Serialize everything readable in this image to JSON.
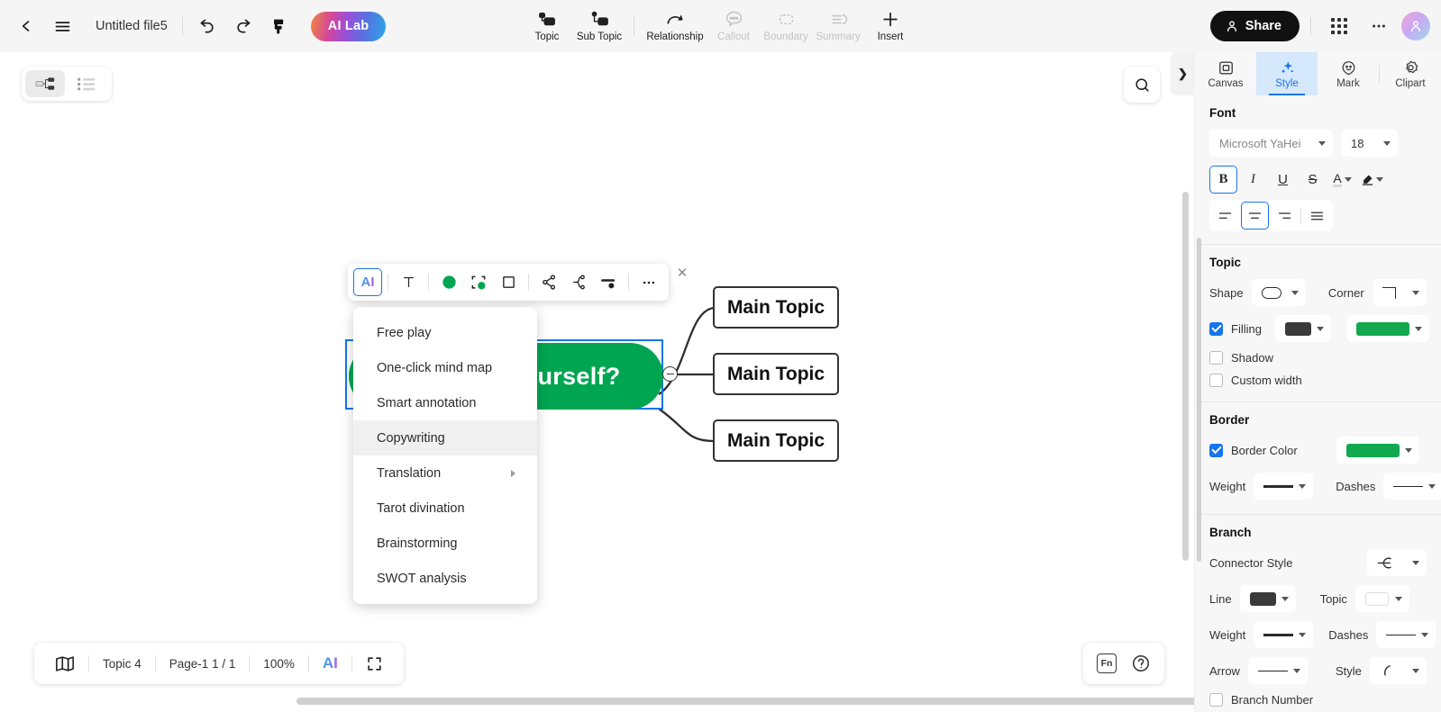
{
  "topbar": {
    "back_icon": "chevron-left-icon",
    "menu_icon": "hamburger-menu-icon",
    "file_title": "Untitled file5",
    "undo_icon": "undo-icon",
    "redo_icon": "redo-icon",
    "format_painter_icon": "format-painter-icon",
    "ai_lab_label": "AI Lab",
    "tools": [
      {
        "label": "Topic",
        "icon": "topic-icon",
        "disabled": false
      },
      {
        "label": "Sub Topic",
        "icon": "sub-topic-icon",
        "disabled": false
      },
      {
        "label": "Relationship",
        "icon": "relationship-icon",
        "disabled": false
      },
      {
        "label": "Callout",
        "icon": "callout-icon",
        "disabled": true
      },
      {
        "label": "Boundary",
        "icon": "boundary-icon",
        "disabled": true
      },
      {
        "label": "Summary",
        "icon": "summary-icon",
        "disabled": true
      },
      {
        "label": "Insert",
        "icon": "plus-icon",
        "disabled": false
      }
    ],
    "share_label": "Share",
    "apps_icon": "apps-grid-icon",
    "more_icon": "more-horizontal-icon",
    "avatar_icon": "user-avatar"
  },
  "canvas": {
    "view_toggle": {
      "mindmap_label": "mindmap-view",
      "outline_label": "outline-view",
      "active": "mindmap-view"
    },
    "search_icon": "search-icon",
    "center_node": {
      "text": "yourself?",
      "fill": "#00a551",
      "selected": true
    },
    "main_topics": [
      {
        "text": "Main Topic"
      },
      {
        "text": "Main Topic"
      },
      {
        "text": "Main Topic"
      }
    ]
  },
  "floatbar": {
    "items": [
      {
        "icon": "ai-icon",
        "label": "AI",
        "selected": true
      },
      {
        "icon": "text-format-icon",
        "label": "T",
        "selected": false
      },
      {
        "icon": "fill-color-icon",
        "label": "",
        "selected": false
      },
      {
        "icon": "border-color-icon",
        "label": "",
        "selected": false
      },
      {
        "icon": "shape-icon",
        "label": "",
        "selected": false
      },
      {
        "icon": "branch-structure-icon",
        "label": "",
        "selected": false
      },
      {
        "icon": "sub-structure-icon",
        "label": "",
        "selected": false
      },
      {
        "icon": "line-style-icon",
        "label": "",
        "selected": false
      },
      {
        "icon": "more-horizontal-icon",
        "label": "",
        "selected": false
      }
    ],
    "close_icon": "close-icon"
  },
  "ai_menu": {
    "items": [
      {
        "label": "Free play",
        "submenu": false,
        "highlighted": false
      },
      {
        "label": "One-click mind map",
        "submenu": false,
        "highlighted": false
      },
      {
        "label": "Smart annotation",
        "submenu": false,
        "highlighted": false
      },
      {
        "label": "Copywriting",
        "submenu": false,
        "highlighted": true
      },
      {
        "label": "Translation",
        "submenu": true,
        "highlighted": false
      },
      {
        "label": "Tarot divination",
        "submenu": false,
        "highlighted": false
      },
      {
        "label": "Brainstorming",
        "submenu": false,
        "highlighted": false
      },
      {
        "label": "SWOT analysis",
        "submenu": false,
        "highlighted": false
      }
    ]
  },
  "statusbar": {
    "map_icon": "map-overview-icon",
    "topic_count": "Topic 4",
    "page_info": "Page-1  1 / 1",
    "zoom": "100%",
    "ai_label": "AI",
    "fullscreen_icon": "fullscreen-icon"
  },
  "helpbar": {
    "fn_label": "Fn",
    "help_label": "?"
  },
  "panel": {
    "collapse_icon": "chevron-right-icon",
    "tabs": [
      {
        "label": "Canvas",
        "icon": "canvas-icon",
        "active": false
      },
      {
        "label": "Style",
        "icon": "style-sparkle-icon",
        "active": true
      },
      {
        "label": "Mark",
        "icon": "mark-smiley-icon",
        "active": false
      },
      {
        "label": "Clipart",
        "icon": "clipart-icon",
        "active": false
      }
    ],
    "font": {
      "title": "Font",
      "family": "Microsoft YaHei",
      "size": "18",
      "bold_label": "B",
      "italic_label": "I",
      "underline_label": "U",
      "strike_label": "S",
      "text_color_label": "A",
      "highlight_label": "highlight",
      "bold_active": true,
      "align_active": "center",
      "aligns": [
        "align-left",
        "align-center",
        "align-right",
        "align-justify"
      ]
    },
    "topic": {
      "title": "Topic",
      "shape_label": "Shape",
      "shape_value": "oval",
      "corner_label": "Corner",
      "corner_value": "square-corner",
      "filling_label": "Filling",
      "filling_checked": true,
      "filling_text_color": "#3a3a3a",
      "filling_color": "#11a84f",
      "shadow_label": "Shadow",
      "shadow_checked": false,
      "custom_width_label": "Custom width",
      "custom_width_checked": false
    },
    "border": {
      "title": "Border",
      "border_color_label": "Border Color",
      "border_color_checked": true,
      "border_color": "#11a84f",
      "weight_label": "Weight",
      "dashes_label": "Dashes"
    },
    "branch": {
      "title": "Branch",
      "connector_style_label": "Connector Style",
      "line_label": "Line",
      "line_color": "#3a3a3a",
      "topic_label": "Topic",
      "topic_color": "#ffffff",
      "weight_label": "Weight",
      "dashes_label": "Dashes",
      "arrow_label": "Arrow",
      "style_label": "Style",
      "branch_number_label": "Branch Number",
      "branch_number_checked": false
    }
  }
}
